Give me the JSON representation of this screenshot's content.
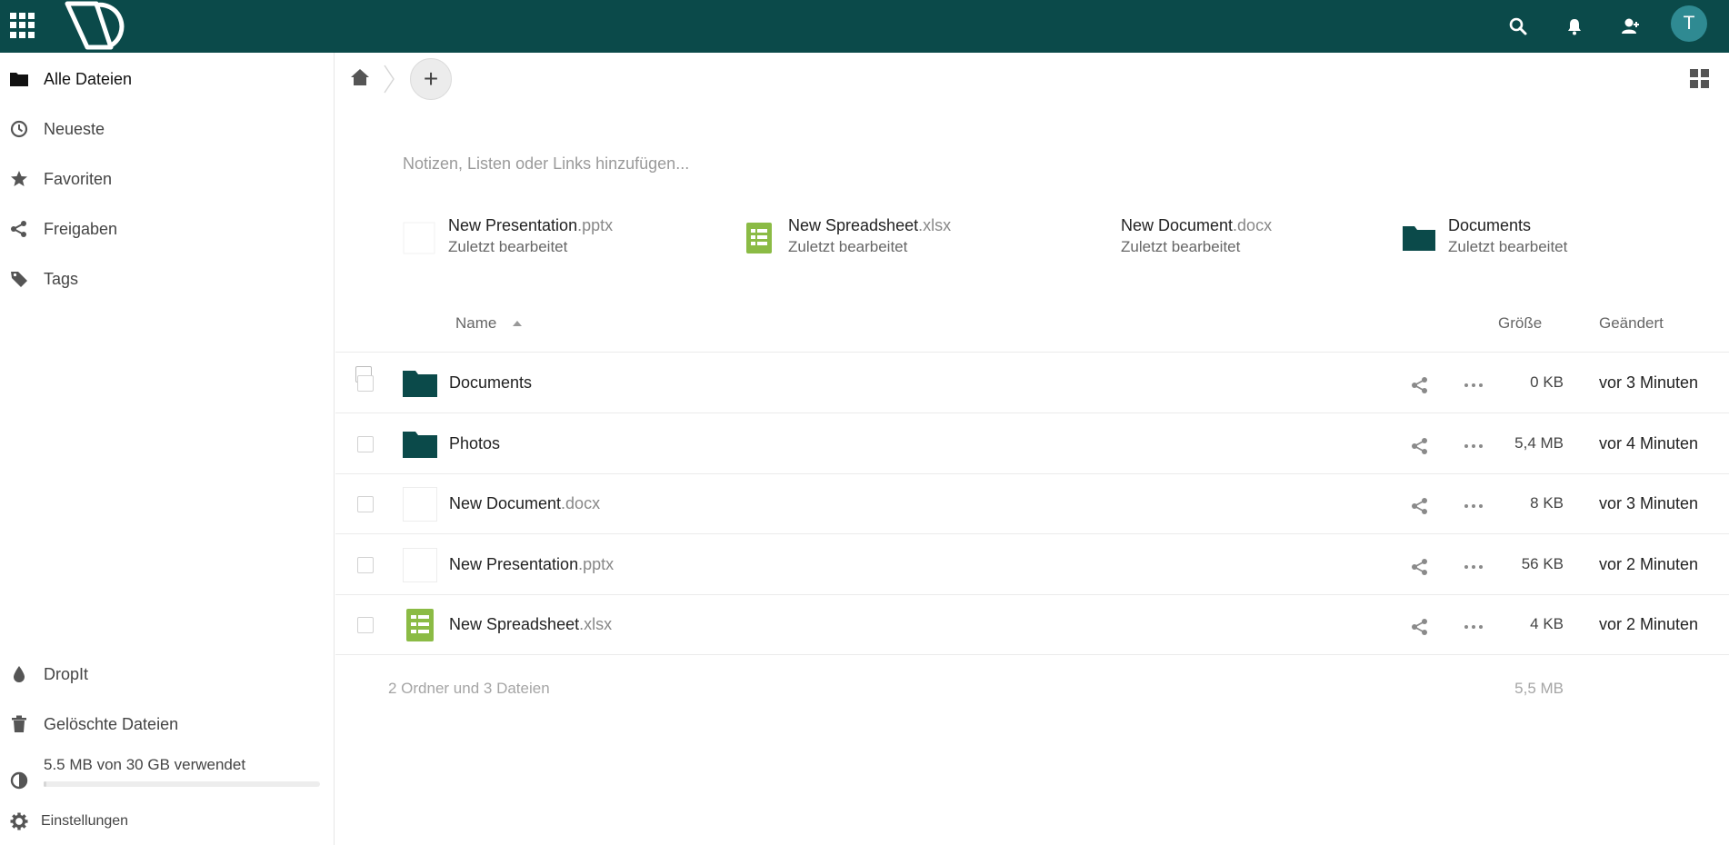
{
  "header": {
    "user_initial": "T",
    "bg_color": "#0b4a4a",
    "avatar_color": "#2f8a92",
    "icons": [
      "apps-icon",
      "search-icon",
      "bell-icon",
      "contacts-icon"
    ]
  },
  "sidebar": {
    "items": [
      {
        "label": "Alle Dateien",
        "icon": "folder-icon"
      },
      {
        "label": "Neueste",
        "icon": "clock-icon"
      },
      {
        "label": "Favoriten",
        "icon": "star-icon"
      },
      {
        "label": "Freigaben",
        "icon": "share-icon"
      },
      {
        "label": "Tags",
        "icon": "tag-icon"
      }
    ],
    "bottom_items": [
      {
        "label": "DropIt",
        "icon": "drop-icon"
      },
      {
        "label": "Gelöschte Dateien",
        "icon": "trash-icon"
      }
    ],
    "quota": {
      "label": "5.5 MB von 30 GB verwendet",
      "percent": 1
    },
    "settings_label": "Einstellungen"
  },
  "main": {
    "notes_placeholder": "Notizen, Listen oder Links hinzufügen...",
    "recent": [
      {
        "base": "New Presentation",
        "ext": ".pptx",
        "subtitle": "Zuletzt bearbeitet",
        "icon": "presentation-icon"
      },
      {
        "base": "New Spreadsheet",
        "ext": ".xlsx",
        "subtitle": "Zuletzt bearbeitet",
        "icon": "spreadsheet-icon"
      },
      {
        "base": "New Document",
        "ext": ".docx",
        "subtitle": "Zuletzt bearbeitet",
        "icon": "document-icon"
      },
      {
        "base": "Documents",
        "ext": "",
        "subtitle": "Zuletzt bearbeitet",
        "icon": "folder-icon"
      }
    ],
    "table": {
      "columns": {
        "name": "Name",
        "size": "Größe",
        "modified": "Geändert"
      },
      "rows": [
        {
          "base": "Documents",
          "ext": "",
          "size": "0 KB",
          "modified": "vor 3 Minuten",
          "type": "folder"
        },
        {
          "base": "Photos",
          "ext": "",
          "size": "5,4 MB",
          "modified": "vor 4 Minuten",
          "type": "folder"
        },
        {
          "base": "New Document",
          "ext": ".docx",
          "size": "8 KB",
          "modified": "vor 3 Minuten",
          "type": "document"
        },
        {
          "base": "New Presentation",
          "ext": ".pptx",
          "size": "56 KB",
          "modified": "vor 2 Minuten",
          "type": "presentation"
        },
        {
          "base": "New Spreadsheet",
          "ext": ".xlsx",
          "size": "4 KB",
          "modified": "vor 2 Minuten",
          "type": "spreadsheet"
        }
      ],
      "summary": {
        "count": "2 Ordner und 3 Dateien",
        "size": "5,5 MB"
      }
    },
    "colors": {
      "folder": "#0b4a4a",
      "spreadsheet": "#8bbb45"
    }
  }
}
